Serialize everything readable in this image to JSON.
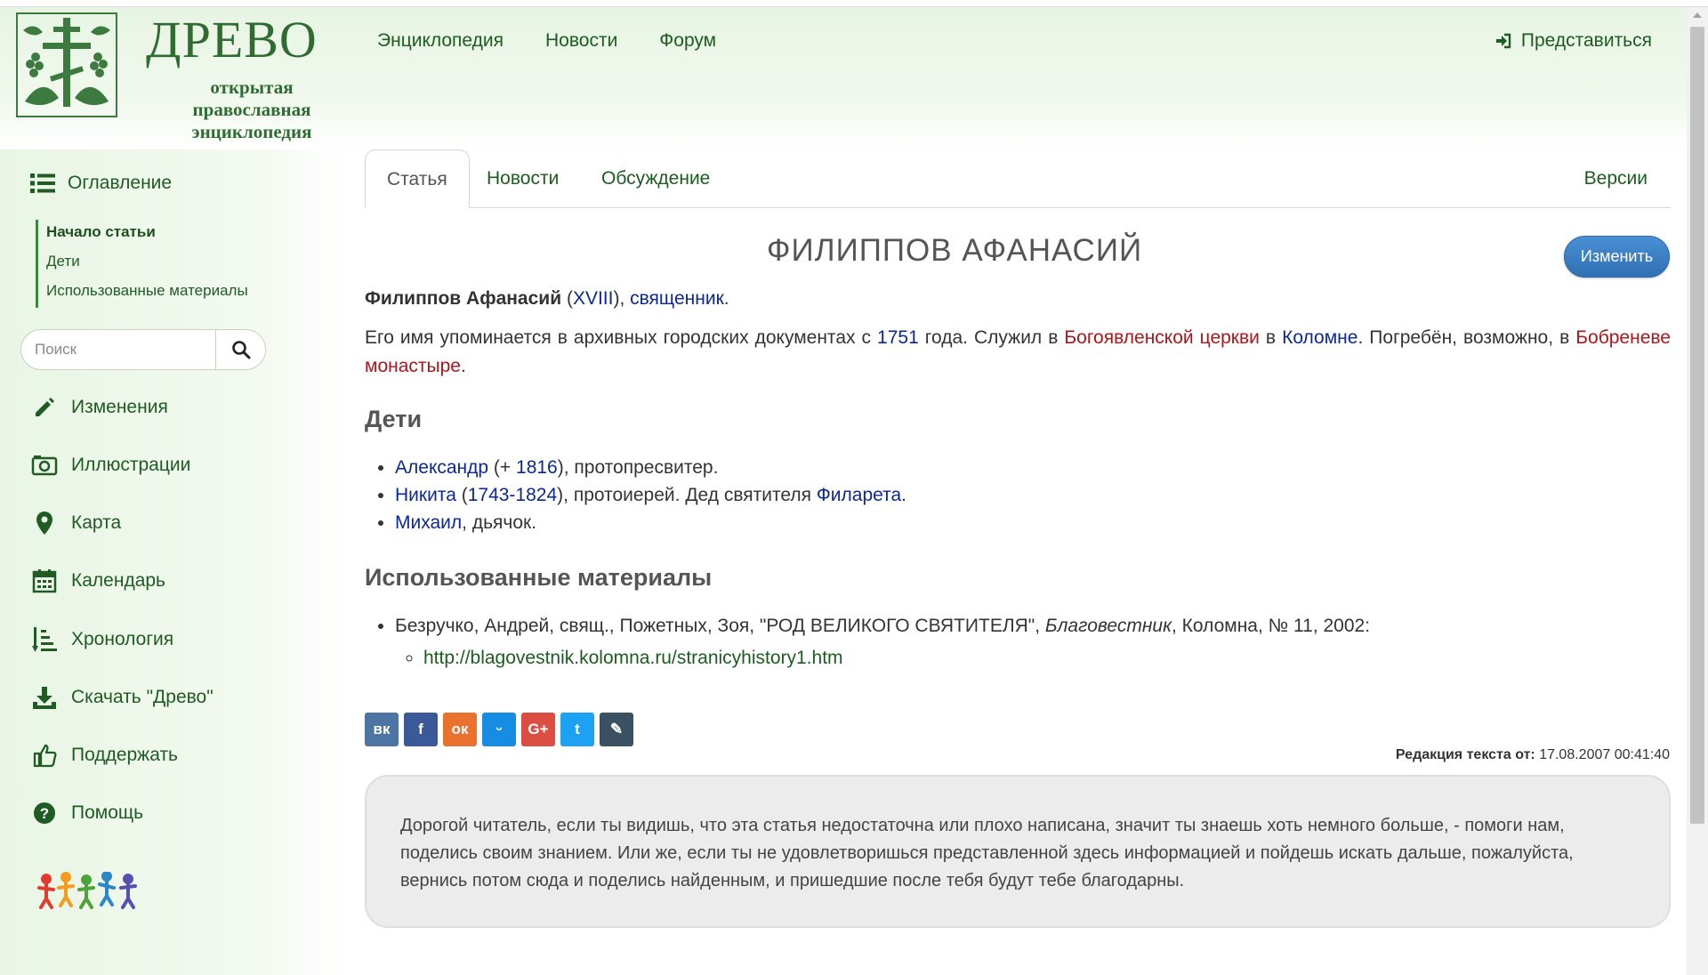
{
  "logo": {
    "title": "ДРЕВО",
    "subtitle_lines": [
      "открытая",
      "православная",
      "энциклопедия"
    ],
    "emblem": "orthodox-cross-vine-emblem"
  },
  "top_nav": {
    "items": [
      {
        "label": "Энциклопедия"
      },
      {
        "label": "Новости"
      },
      {
        "label": "Форум"
      }
    ],
    "login_label": "Представиться",
    "login_icon": "sign-in-icon"
  },
  "sidebar": {
    "toc_label": "Оглавление",
    "toc_items": [
      {
        "label": "Начало статьи",
        "active": true
      },
      {
        "label": "Дети",
        "active": false
      },
      {
        "label": "Использованные материалы",
        "active": false
      }
    ],
    "search_placeholder": "Поиск",
    "items": [
      {
        "label": "Изменения",
        "icon": "pencil-icon"
      },
      {
        "label": "Иллюстрации",
        "icon": "camera-icon"
      },
      {
        "label": "Карта",
        "icon": "map-marker-icon"
      },
      {
        "label": "Календарь",
        "icon": "calendar-icon"
      },
      {
        "label": "Хронология",
        "icon": "chronology-icon"
      },
      {
        "label": "Скачать \"Древо\"",
        "icon": "download-icon"
      },
      {
        "label": "Поддержать",
        "icon": "thumbs-up-icon"
      },
      {
        "label": "Помощь",
        "icon": "question-icon"
      }
    ],
    "accent_color": "#1f5b23"
  },
  "tabs": {
    "items": [
      {
        "label": "Статья",
        "active": true
      },
      {
        "label": "Новости",
        "active": false
      },
      {
        "label": "Обсуждение",
        "active": false
      }
    ],
    "versions_label": "Версии"
  },
  "article": {
    "title": "ФИЛИППОВ АФАНАСИЙ",
    "edit_label": "Изменить",
    "lead": {
      "name": "Филиппов Афанасий",
      "open": " (",
      "century": "XVIII",
      "mid": "), ",
      "role": "священник",
      "end": "."
    },
    "body": {
      "t1": "Его имя упоминается в архивных городских документах с ",
      "year": "1751",
      "t2": " года. Служил в ",
      "church": "Богоявленской церкви",
      "t3": " в ",
      "city": "Коломне",
      "t4": ". Погребён, возможно, в ",
      "monastery": "Бобреневе монастыре",
      "t5": "."
    },
    "children_heading": "Дети",
    "children": [
      {
        "name": "Александр",
        "sep1": " (+ ",
        "date": "1816",
        "rest": "), протопресвитер."
      },
      {
        "name": "Никита",
        "sep1": " (",
        "date": "1743-1824",
        "rest": "), протоиерей. Дед святителя ",
        "link2": "Филарета",
        "end": "."
      },
      {
        "name": "Михаил",
        "rest": ", дьячок."
      }
    ],
    "materials_heading": "Использованные материалы",
    "materials": [
      {
        "text": "Безручко, Андрей, свящ., Пожетных, Зоя, \"РОД ВЕЛИКОГО СВЯТИТЕЛЯ\", ",
        "journal": "Благовестник",
        "text2": ", Коломна, № 11, 2002:",
        "url": "http://blagovestnik.kolomna.ru/stranicyhistory1.htm"
      }
    ],
    "share": [
      {
        "icon": "vk-icon",
        "glyph": "вк",
        "color": "#4c75a3"
      },
      {
        "icon": "facebook-icon",
        "glyph": "f",
        "color": "#3b5998"
      },
      {
        "icon": "odnoklassniki-icon",
        "glyph": "ок",
        "color": "#eb722e"
      },
      {
        "icon": "moimir-icon",
        "glyph": "ᵕ",
        "color": "#168de2"
      },
      {
        "icon": "google-plus-icon",
        "glyph": "G+",
        "color": "#dc4e41"
      },
      {
        "icon": "twitter-icon",
        "glyph": "t",
        "color": "#1da1f2"
      },
      {
        "icon": "livejournal-icon",
        "glyph": "✎",
        "color": "#3b5161"
      }
    ],
    "revision_label": "Редакция текста от:",
    "revision_date": "17.08.2007 00:41:40",
    "notice": "Дорогой читатель, если ты видишь, что эта статья недостаточна или плохо написана, значит ты знаешь хоть немного больше, - помоги нам, поделись своим знанием. Или же, если ты не удовлетворишься представленной здесь информацией и пойдешь искать дальше, пожалуйста, вернись потом сюда и поделись найденным, и пришедшие после тебя будут тебе благодарны."
  },
  "colors": {
    "link_blue": "#0b2893",
    "link_red": "#a8171c",
    "link_green": "#1c5c20",
    "button_blue": "#2f70b3"
  }
}
